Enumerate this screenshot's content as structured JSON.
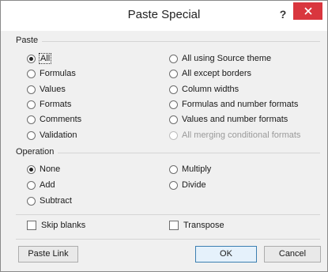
{
  "window": {
    "title": "Paste Special",
    "help_glyph": "?"
  },
  "paste": {
    "label": "Paste",
    "left": [
      {
        "label": "All",
        "checked": true
      },
      {
        "label": "Formulas",
        "checked": false
      },
      {
        "label": "Values",
        "checked": false
      },
      {
        "label": "Formats",
        "checked": false
      },
      {
        "label": "Comments",
        "checked": false
      },
      {
        "label": "Validation",
        "checked": false
      }
    ],
    "right": [
      {
        "label": "All using Source theme",
        "disabled": false
      },
      {
        "label": "All except borders",
        "disabled": false
      },
      {
        "label": "Column widths",
        "disabled": false
      },
      {
        "label": "Formulas and number formats",
        "disabled": false
      },
      {
        "label": "Values and number formats",
        "disabled": false
      },
      {
        "label": "All merging conditional formats",
        "disabled": true
      }
    ]
  },
  "operation": {
    "label": "Operation",
    "left": [
      {
        "label": "None",
        "checked": true
      },
      {
        "label": "Add",
        "checked": false
      },
      {
        "label": "Subtract",
        "checked": false
      }
    ],
    "right": [
      {
        "label": "Multiply",
        "checked": false
      },
      {
        "label": "Divide",
        "checked": false
      }
    ]
  },
  "options": {
    "skip_blanks": "Skip blanks",
    "transpose": "Transpose"
  },
  "buttons": {
    "paste_link": "Paste Link",
    "ok": "OK",
    "cancel": "Cancel"
  },
  "colors": {
    "close_button": "#d9363e",
    "dialog_bg": "#f0f0f0"
  }
}
